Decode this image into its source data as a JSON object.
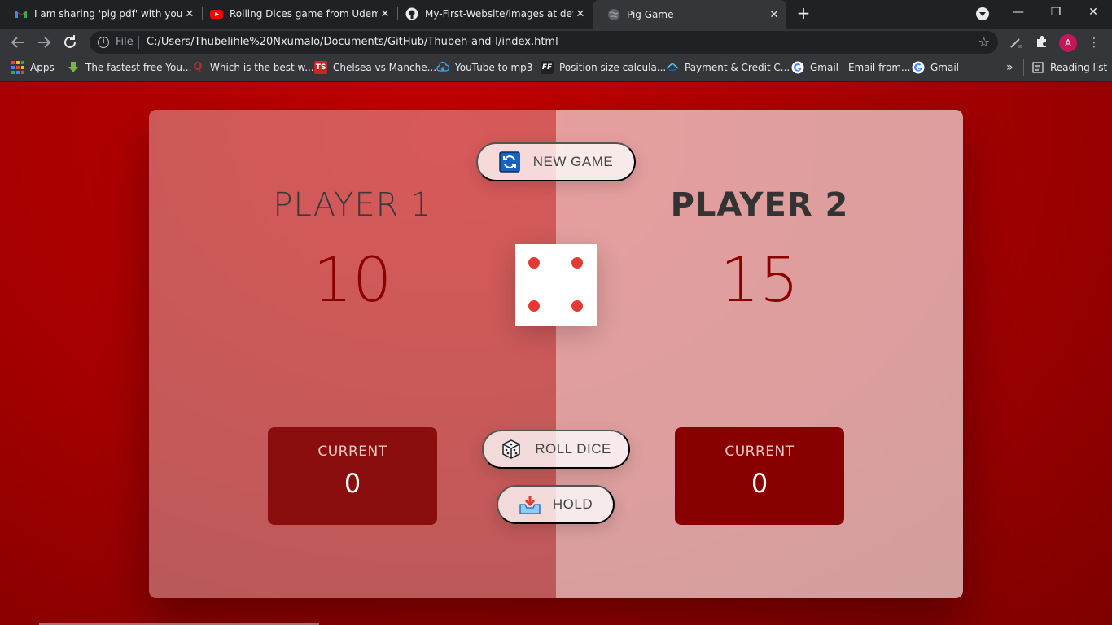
{
  "browser": {
    "tabs": [
      {
        "title": "I am sharing 'pig pdf' with you - ",
        "icon": "gmail-icon",
        "active": false
      },
      {
        "title": "Rolling Dices game from Udemy",
        "icon": "youtube-icon",
        "active": false
      },
      {
        "title": "My-First-Website/images at deve",
        "icon": "github-icon",
        "active": false
      },
      {
        "title": "Pig Game",
        "icon": "globe-icon",
        "active": true
      }
    ],
    "close_glyph": "✕",
    "new_tab_glyph": "+",
    "window_controls": {
      "minimize": "—",
      "restore": "❐",
      "close": "✕"
    },
    "omnibox": {
      "scheme_label": "File",
      "url": "C:/Users/Thubelihle%20Nxumalo/Documents/GitHub/Thubeh-and-I/index.html"
    },
    "profile_initial": "A",
    "bookmarks": [
      {
        "label": "Apps",
        "icon": "apps-grid-icon"
      },
      {
        "label": "The fastest free You...",
        "icon": "download-arrow-icon",
        "color": "#7cb342"
      },
      {
        "label": "Which is the best w...",
        "icon": "quora-icon",
        "color": "#b92b27"
      },
      {
        "label": "Chelsea vs Manche...",
        "icon": "ts-icon",
        "color": "#c62828"
      },
      {
        "label": "YouTube to mp3",
        "icon": "cloud-download-icon",
        "color": "#1e88e5"
      },
      {
        "label": "Position size calcula...",
        "icon": "ff-icon",
        "color": "#424242"
      },
      {
        "label": "Payment & Credit C...",
        "icon": "house-icon",
        "color": "#4fc3f7"
      },
      {
        "label": "Gmail - Email from...",
        "icon": "google-icon",
        "color": "#ffffff"
      },
      {
        "label": "Gmail",
        "icon": "google-icon",
        "color": "#ffffff"
      }
    ],
    "bookmarks_overflow": "»",
    "reading_list": "Reading list"
  },
  "game": {
    "players": [
      {
        "name": "PLAYER 1",
        "score": "10",
        "current_label": "CURRENT",
        "current_score": "0",
        "active": false
      },
      {
        "name": "PLAYER 2",
        "score": "15",
        "current_label": "CURRENT",
        "current_score": "0",
        "active": true
      }
    ],
    "buttons": {
      "new_game": "NEW GAME",
      "roll_dice": "ROLL DICE",
      "hold": "HOLD"
    },
    "dice_value": 4,
    "colors": {
      "background": "#c40000",
      "score": "#8b0000",
      "pip": "#e53935"
    }
  }
}
